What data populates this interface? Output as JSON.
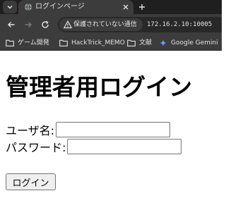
{
  "browser": {
    "tab": {
      "title": "ログインページ"
    },
    "address_bar": {
      "security_text": "保護されていない通信",
      "url": "172.16.2.10:10005"
    },
    "bookmarks": [
      {
        "label": "ゲーム開発",
        "icon": "folder-icon"
      },
      {
        "label": "HackTrick_MEMO",
        "icon": "folder-icon"
      },
      {
        "label": "文献",
        "icon": "folder-icon"
      },
      {
        "label": "Google Gemini",
        "icon": "gemini-sparkle-icon"
      }
    ]
  },
  "page": {
    "title": "管理者用ログイン",
    "form": {
      "username_label": "ユーザ名:",
      "username_value": "",
      "password_label": "パスワード:",
      "password_value": "",
      "submit_label": "ログイン"
    }
  },
  "colors": {
    "tabstrip": "#1f1f1f",
    "toolbar": "#3c3c3c",
    "omnibox": "#282828",
    "chrome_text": "#e3e3e3",
    "page_background": "#ffffff"
  }
}
